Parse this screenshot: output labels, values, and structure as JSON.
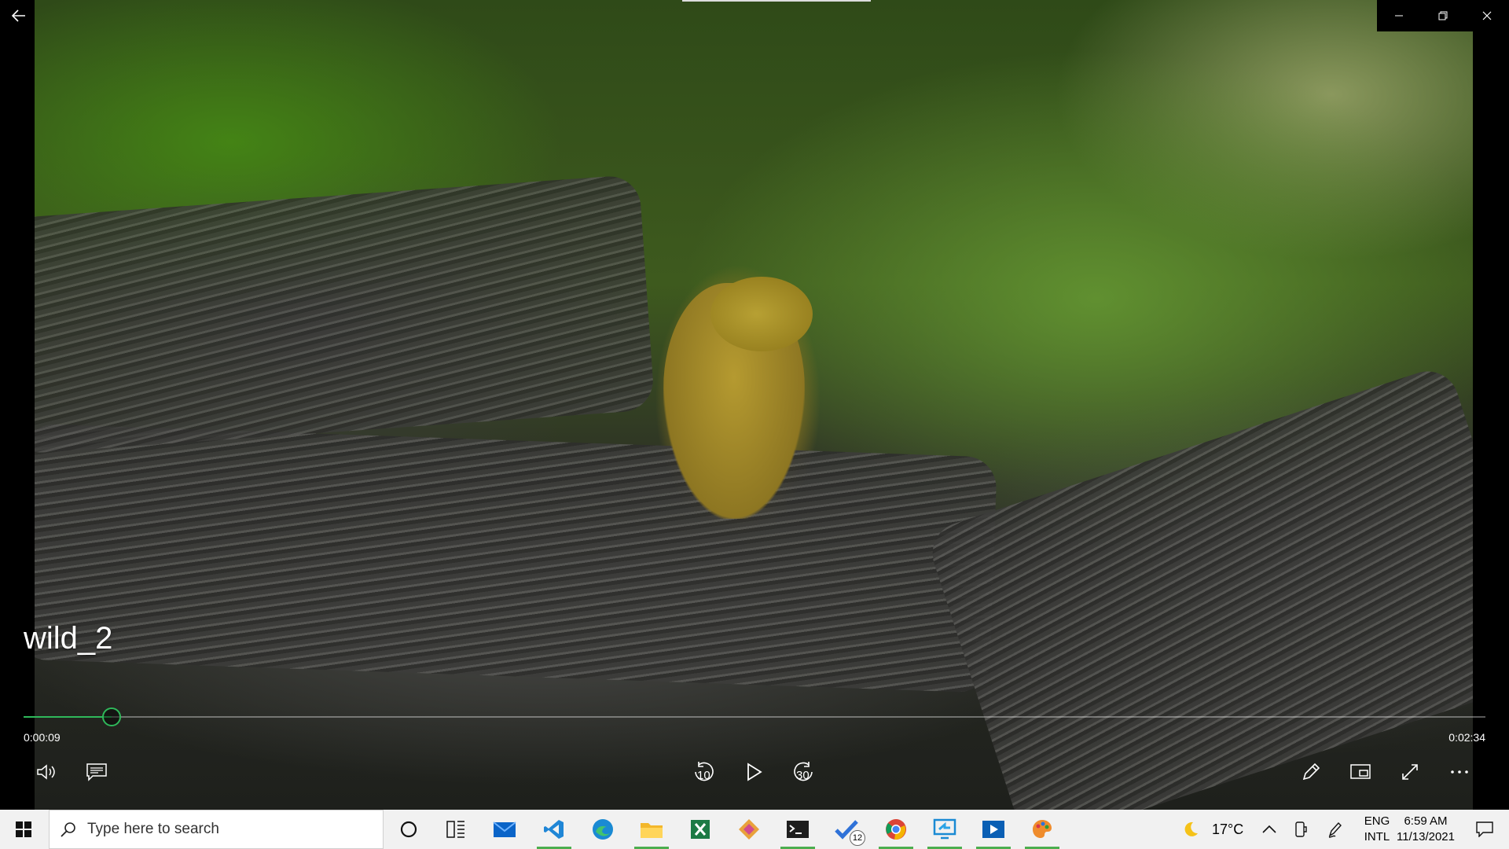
{
  "player": {
    "title": "wild_2",
    "time_current": "0:00:09",
    "time_total": "0:02:34",
    "progress_fraction": 0.06,
    "accent_color": "#2fb85a",
    "skip_back_label": "10",
    "skip_forward_label": "30"
  },
  "taskbar": {
    "search_placeholder": "Type here to search",
    "weather": "17°C",
    "lang_primary": "ENG",
    "lang_secondary": "INTL",
    "time": "6:59 AM",
    "date": "11/13/2021",
    "todo_badge": "12",
    "apps": [
      "cortana-icon",
      "task-view-icon",
      "mail-icon",
      "vscode-icon",
      "edge-icon",
      "file-explorer-icon",
      "excel-icon",
      "app-diamond-icon",
      "terminal-icon",
      "todo-icon",
      "chrome-icon",
      "remote-desktop-icon",
      "movies-tv-icon",
      "paint-icon"
    ]
  }
}
